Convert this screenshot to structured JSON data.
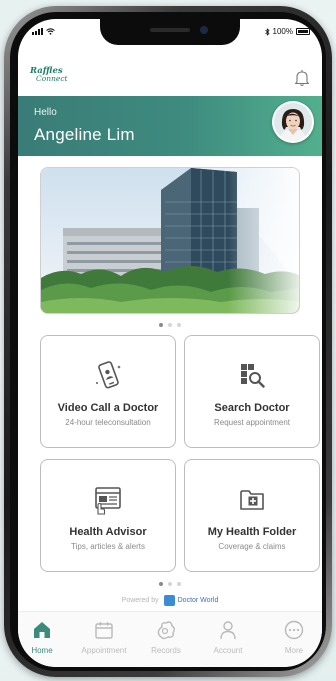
{
  "status_bar": {
    "battery": "100%"
  },
  "app": {
    "logo_line1": "Raffles",
    "logo_line2": "Connect"
  },
  "greeting": {
    "hello": "Hello",
    "name": "Angeline Lim"
  },
  "carousel_dots": 3,
  "services": [
    {
      "title": "Video Call a Doctor",
      "subtitle": "24-hour teleconsultation",
      "icon": "video-call-icon"
    },
    {
      "title": "Search Doctor",
      "subtitle": "Request appointment",
      "icon": "search-doctor-icon"
    },
    {
      "title": "Health Advisor",
      "subtitle": "Tips, articles & alerts",
      "icon": "health-advisor-icon"
    },
    {
      "title": "My Health Folder",
      "subtitle": "Coverage & claims",
      "icon": "health-folder-icon"
    }
  ],
  "powered_by": {
    "label": "Powered by",
    "brand": "Doctor World"
  },
  "tabs": [
    {
      "label": "Home",
      "icon": "home-icon",
      "active": true
    },
    {
      "label": "Appointment",
      "icon": "calendar-icon",
      "active": false
    },
    {
      "label": "Records",
      "icon": "records-icon",
      "active": false
    },
    {
      "label": "Account",
      "icon": "account-icon",
      "active": false
    },
    {
      "label": "More",
      "icon": "more-icon",
      "active": false
    }
  ],
  "colors": {
    "brand_green": "#3e8b7f",
    "brand_green_light": "#52b08e",
    "inactive": "#bcbcbc"
  }
}
